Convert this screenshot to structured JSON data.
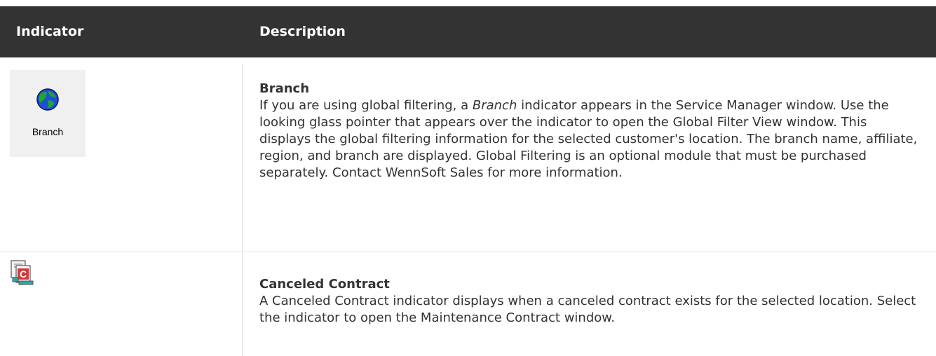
{
  "table": {
    "headers": [
      "Indicator",
      "Description"
    ],
    "rows": [
      {
        "icon": "globe-icon",
        "icon_label": "Branch",
        "title": "Branch",
        "text_before_em": "If you are using global filtering, a ",
        "em": "Branch",
        "text_after_em": " indicator appears in the Service Manager window. Use the looking glass pointer that appears over the indicator to open the Global Filter View window. This displays the global filtering information for the selected customer's location. The branch name, affiliate, region, and branch are displayed. Global Filtering is an optional module that must be purchased separately. Contact WennSoft Sales for more information."
      },
      {
        "icon": "canceled-contract-icon",
        "title": "Canceled Contract",
        "text": "A Canceled Contract indicator displays when a canceled contract exists for the selected location. Select the indicator to open the Maintenance Contract window."
      }
    ]
  },
  "colors": {
    "header_bg": "#333333",
    "header_text": "#ffffff",
    "body_text": "#333333",
    "border": "#e0e0e0"
  }
}
